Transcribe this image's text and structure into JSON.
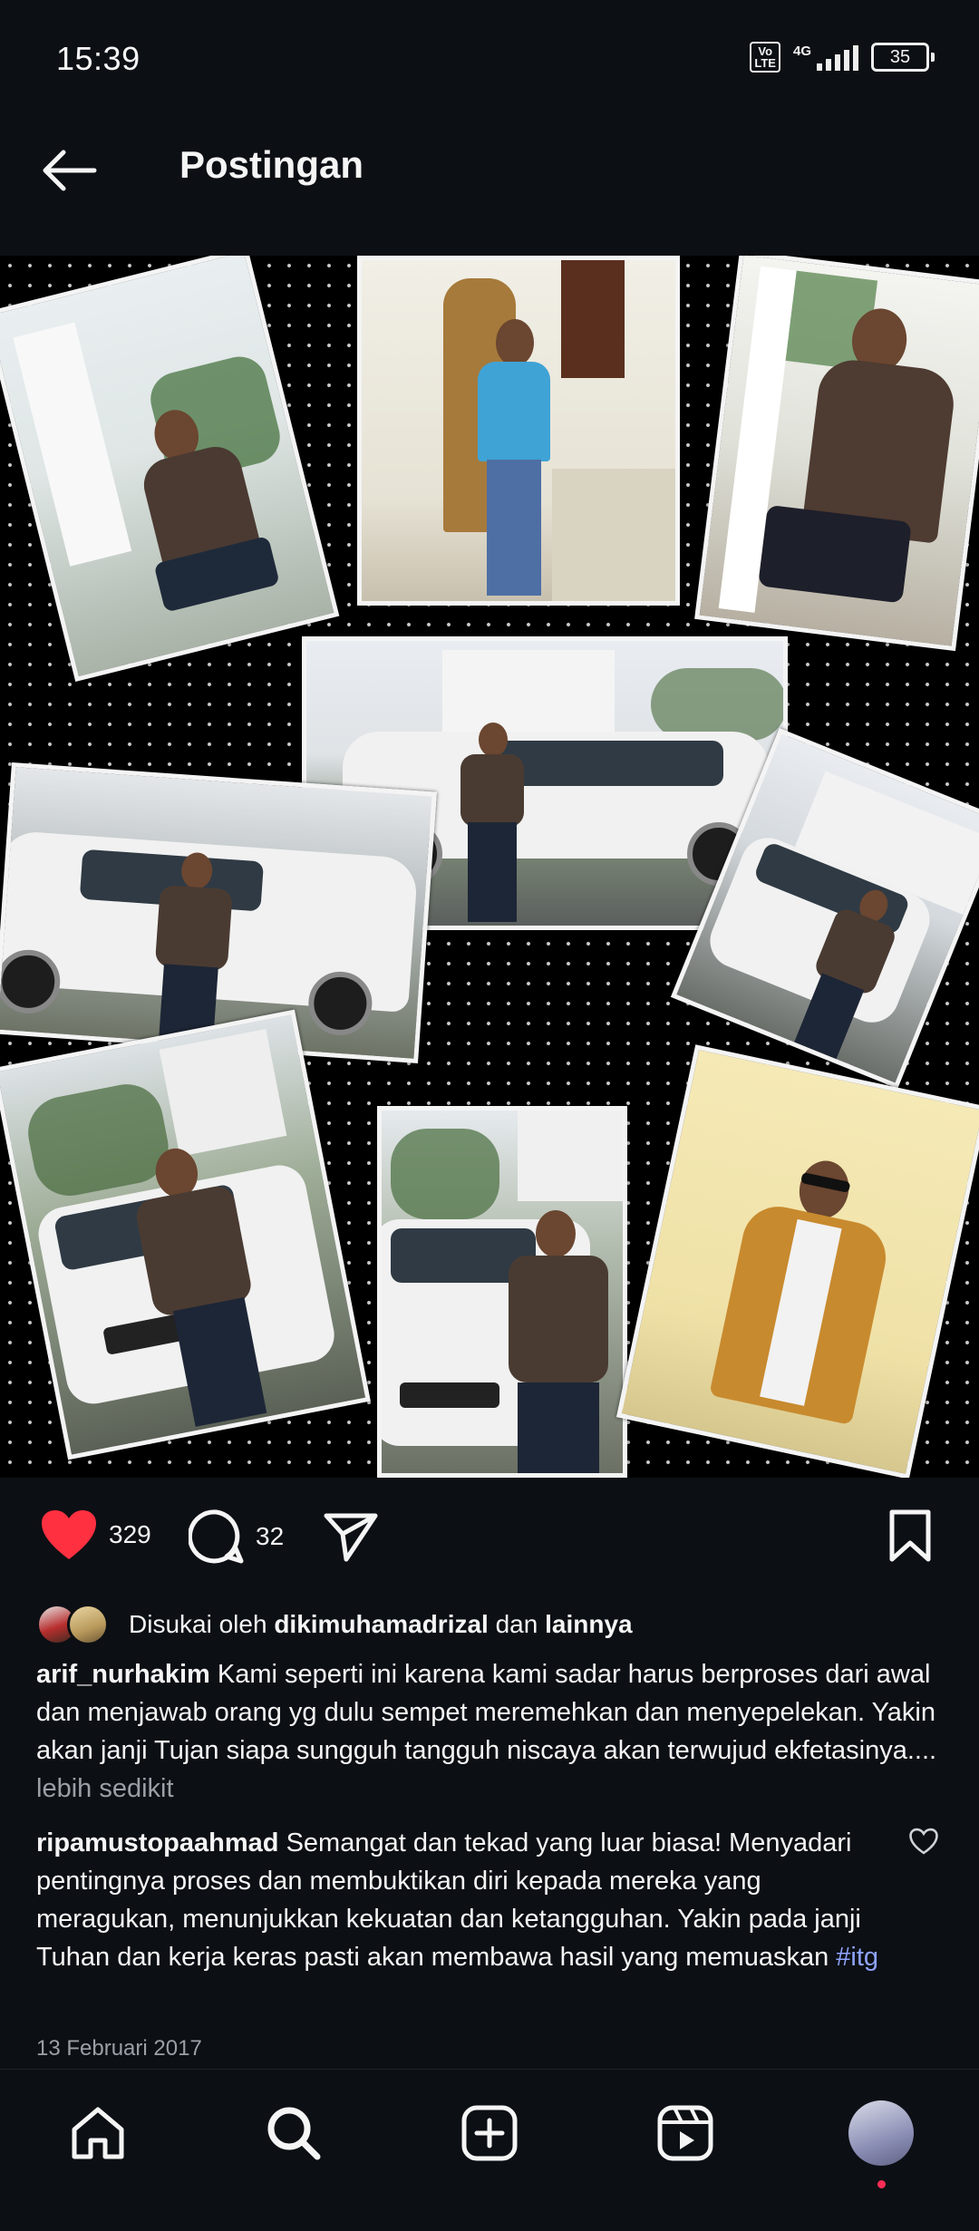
{
  "status_bar": {
    "time": "15:39",
    "volte": "Vo LTE",
    "network": "4G",
    "battery": "35"
  },
  "header": {
    "title": "Postingan",
    "back_icon": "arrow-left-icon"
  },
  "post": {
    "likes_count": "329",
    "comments_count": "32",
    "liked_by_prefix": "Disukai oleh",
    "liked_by_user": "dikimuhamadrizal",
    "liked_by_joiner": "dan",
    "liked_by_others": "lainnya",
    "caption_user": "arif_nurhakim",
    "caption_text": "Kami seperti ini karena kami sadar harus berproses dari awal dan menjawab orang yg dulu sempet meremehkan dan menyepelekan.  Yakin akan janji Tujan siapa sungguh tangguh niscaya akan terwujud ekfetasinya....",
    "caption_more": "lebih sedikit",
    "comment_user": "ripamustopaahmad",
    "comment_text": "Semangat dan tekad yang luar biasa! Menyadari pentingnya proses dan membuktikan diri kepada mereka yang meragukan, menunjukkan kekuatan dan ketangguhan. Yakin pada janji Tuhan dan kerja keras pasti akan membawa hasil yang memuaskan",
    "comment_hashtag": "#itg",
    "date": "13 Februari 2017",
    "like_color": "#ff3040"
  },
  "bottom_nav": {
    "items": [
      "home-icon",
      "search-icon",
      "create-icon",
      "reels-icon",
      "profile-avatar"
    ]
  }
}
